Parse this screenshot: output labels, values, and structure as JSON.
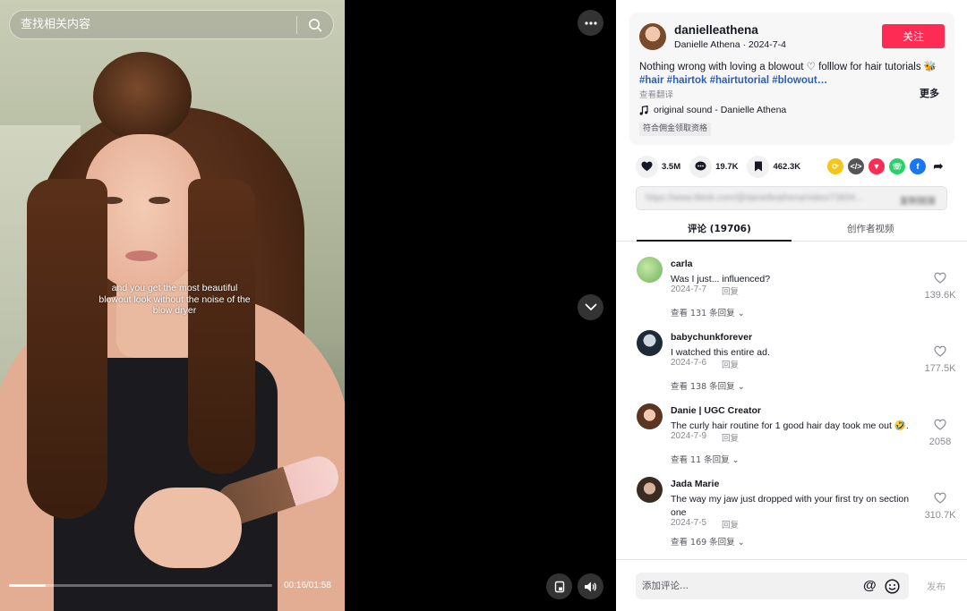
{
  "video": {
    "search_placeholder": "查找相关内容",
    "subtitle": "and you get the most beautiful blowout look without the noise of the blow dryer",
    "time": "00:16/01:58",
    "progress_fraction": 0.14
  },
  "post": {
    "author_handle": "danielleathena",
    "author_sub": "Danielle Athena · 2024-7-4",
    "follow_label": "关注",
    "description": "Nothing wrong with loving a blowout ♡ folllow for hair tutorials 🐝",
    "hashtags": "#hair #hairtok #hairtutorial #blowout…",
    "more_label": "更多",
    "translate_label": "查看翻译",
    "sound": "original sound - Danielle Athena",
    "tag_chip": "符合佣金领取资格"
  },
  "stats": {
    "likes": "3.5M",
    "comments": "19.7K",
    "saves": "462.3K"
  },
  "share": {
    "link": "https://www.tiktok.com/@danielleathena/video/73834...",
    "copy_label": "复制链接"
  },
  "tabs": {
    "comments": "评论 (19706)",
    "creator_videos": "创作者视频"
  },
  "reply_label": "回复",
  "comments": [
    {
      "user": "carla",
      "text": "Was I just... influenced?",
      "date": "2024-7-7",
      "view_replies": "查看 131 条回复",
      "likes": "139.6K"
    },
    {
      "user": "babychunkforever",
      "text": "I watched this entire ad.",
      "date": "2024-7-6",
      "view_replies": "查看 138 条回复",
      "likes": "177.5K"
    },
    {
      "user": "Danie | UGC Creator",
      "text": "The curly hair routine for 1 good hair day took me out 🤣.",
      "date": "2024-7-9",
      "view_replies": "查看 11 条回复",
      "likes": "2058"
    },
    {
      "user": "Jada Marie",
      "text": "The way my jaw just dropped with your first try on section one",
      "date": "2024-7-5",
      "view_replies": "查看 169 条回复",
      "likes": "310.7K"
    }
  ],
  "bottom": {
    "input_placeholder": "添加评论...",
    "post_label": "发布"
  },
  "colors": {
    "accent": "#fe2c55",
    "hashtag": "#2b5db9"
  }
}
